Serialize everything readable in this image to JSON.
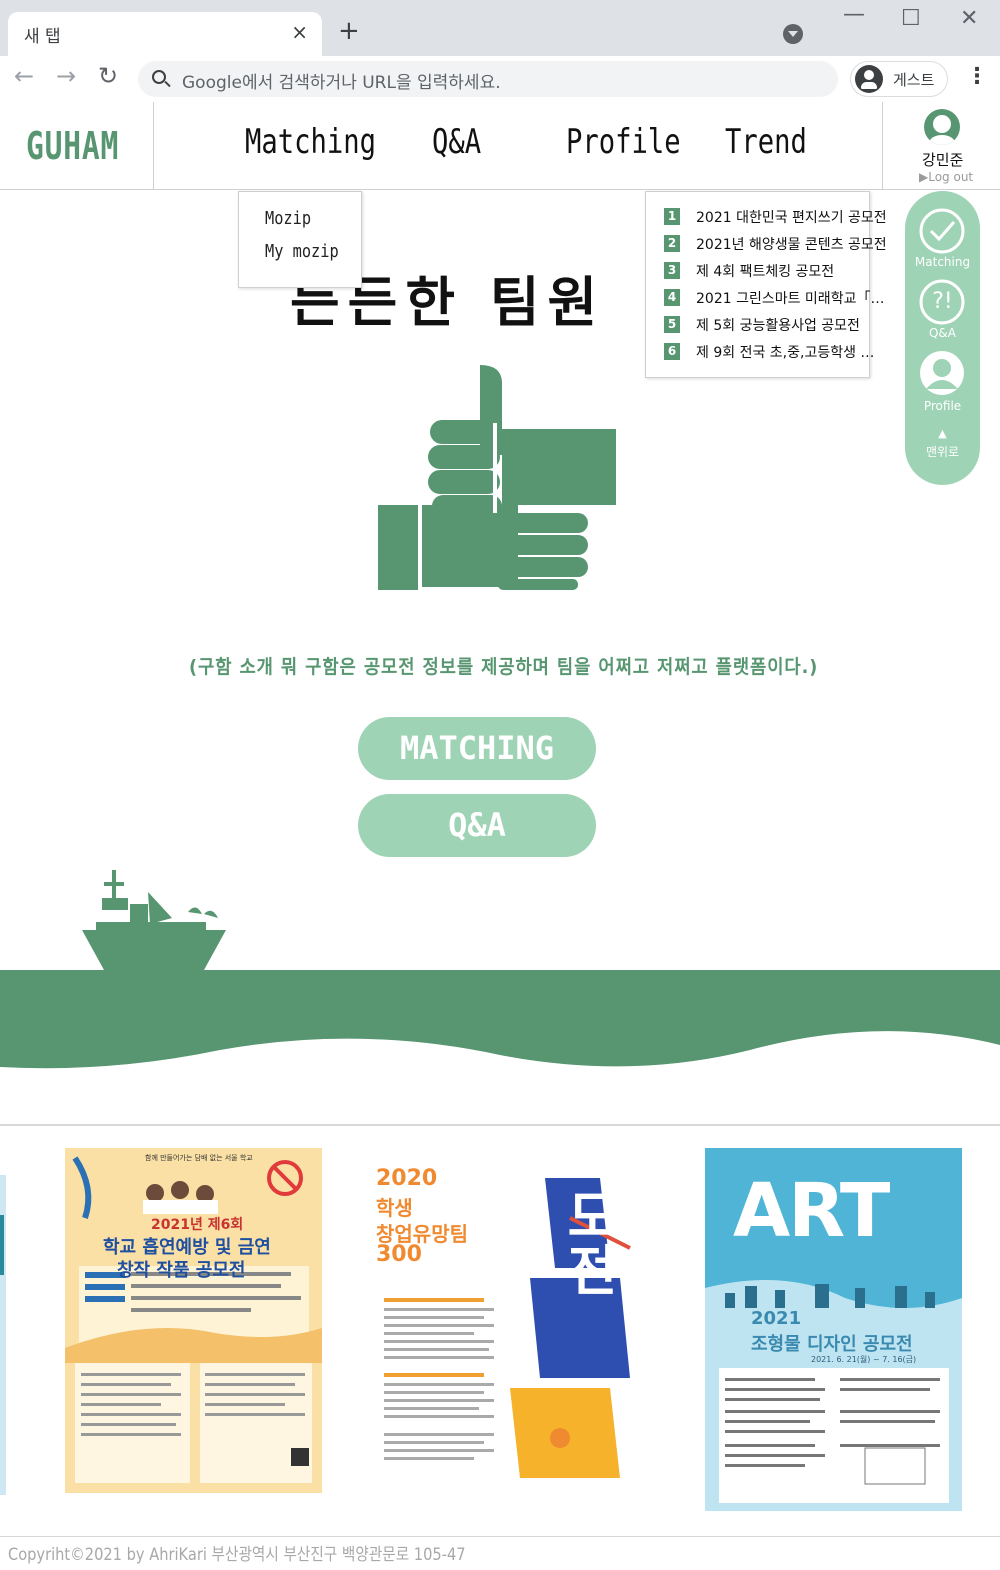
{
  "browser": {
    "tab_title": "새 탭",
    "tab_close": "×",
    "new_tab": "+",
    "omnibox_placeholder": "Google에서 검색하거나 URL을 입력하세요.",
    "profile_label": "게스트",
    "menu": "⋮",
    "back": "←",
    "forward": "→",
    "reload": "↻",
    "minimize": "—",
    "maximize": "☐",
    "close": "✕"
  },
  "header": {
    "logo": "GUHAM",
    "nav": [
      "Matching",
      "Q&A",
      "Profile",
      "Trend"
    ],
    "user_name": "강민준",
    "logout": "▶Log out"
  },
  "matching_dropdown": [
    "Mozip",
    "My mozip"
  ],
  "trend": [
    {
      "rank": "1",
      "title": "2021 대한민국 편지쓰기 공모전"
    },
    {
      "rank": "2",
      "title": "2021년 해양생물 콘텐츠 공모전"
    },
    {
      "rank": "3",
      "title": "제 4회 팩트체킹 공모전"
    },
    {
      "rank": "4",
      "title": "2021 그린스마트 미래학교「…"
    },
    {
      "rank": "5",
      "title": "제 5회 궁능활용사업 공모전"
    },
    {
      "rank": "6",
      "title": "제 9회 전국 초,중,고등학생 …"
    }
  ],
  "hero": {
    "title": "든든한 팀원 모집, 구",
    "description": "(구함 소개 뭐 구함은 공모전 정보를 제공하며 팀을 어쩌고 저쩌고 플랫폼이다.)",
    "buttons": [
      "MATCHING",
      "Q&A"
    ]
  },
  "quick_menu": {
    "items": [
      {
        "label": "Matching",
        "icon": "check-icon"
      },
      {
        "label": "Q&A",
        "icon": "question-exclaim-icon",
        "glyph": "?!"
      },
      {
        "label": "Profile",
        "icon": "user-icon"
      }
    ],
    "top_label": "맨위로",
    "top_glyph": "▲"
  },
  "posters": [
    {
      "name": "smoking-prevention-poster",
      "top": "함께 만들어가는 담배 없는 서울 학교",
      "line1": "2021년 제6회",
      "line2": "학교 흡연예방 및 금연",
      "line3": "창작 작품 공모전"
    },
    {
      "name": "startup-poster",
      "line1": "2020",
      "line2": "학생",
      "line3": "창업유망팀",
      "line4": "300",
      "side": "도전"
    },
    {
      "name": "art-poster",
      "big": "ART",
      "line1": "2021",
      "line2": "조형물 디자인 공모전",
      "line3": "2021. 6. 21(월) ~ 7. 16(금)"
    }
  ],
  "footer": "Copyriht©2021 by AhriKari  부산광역시 부산진구 백양관문로 105-47",
  "colors": {
    "brand": "#579670",
    "light": "#9fd3b5",
    "chrome": "#dee1e6"
  }
}
